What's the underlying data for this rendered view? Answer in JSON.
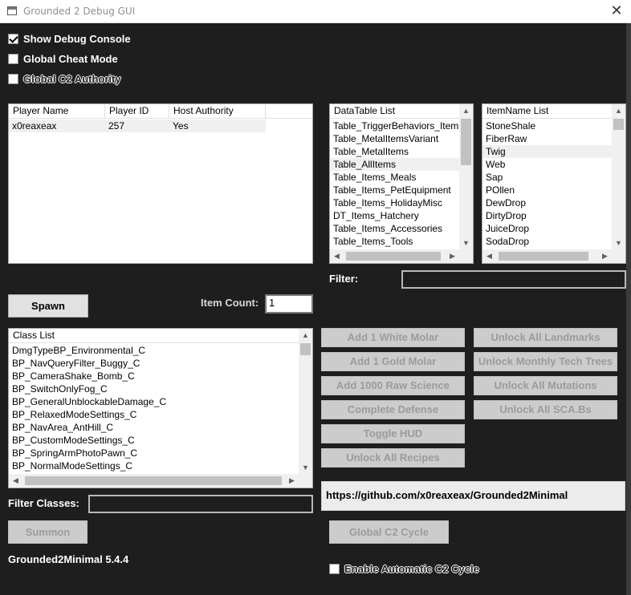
{
  "window": {
    "title": "Grounded 2 Debug GUI",
    "close_glyph": "✕"
  },
  "checkboxes": {
    "show_debug_console": {
      "label": "Show Debug Console",
      "checked": true
    },
    "global_cheat_mode": {
      "label": "Global Cheat Mode",
      "checked": false
    },
    "global_c2_authority": {
      "label": "Global C2 Authority",
      "checked": false
    },
    "enable_auto_c2": {
      "label": "Enable Automatic C2 Cycle",
      "checked": false
    }
  },
  "players": {
    "columns": [
      "Player Name",
      "Player ID",
      "Host Authority"
    ],
    "rows": [
      [
        "x0reaxeax",
        "257",
        "Yes"
      ]
    ]
  },
  "datatable_list": {
    "header": "DataTable List",
    "items": [
      "Table_TriggerBehaviors_Items",
      "Table_MetalItemsVariant",
      "Table_MetalItems",
      "Table_AllItems",
      "Table_Items_Meals",
      "Table_Items_PetEquipment",
      "Table_Items_HolidayMisc",
      "DT_Items_Hatchery",
      "Table_Items_Accessories",
      "Table_Items_Tools"
    ],
    "selected": 3
  },
  "itemname_list": {
    "header": "ItemName List",
    "items": [
      "StoneShale",
      "FiberRaw",
      "Twig",
      "Web",
      "Sap",
      "POllen",
      "DewDrop",
      "DirtyDrop",
      "JuiceDrop",
      "SodaDrop"
    ],
    "selected": 2
  },
  "filter": {
    "label": "Filter:",
    "value": ""
  },
  "spawn": {
    "button_label": "Spawn",
    "item_count_label": "Item Count:",
    "item_count_value": "1"
  },
  "class_list": {
    "header": "Class List",
    "items": [
      "DmgTypeBP_Environmental_C",
      "BP_NavQueryFilter_Buggy_C",
      "BP_CameraShake_Bomb_C",
      "BP_SwitchOnlyFog_C",
      "BP_GeneralUnblockableDamage_C",
      "BP_RelaxedModeSettings_C",
      "BP_NavArea_AntHill_C",
      "BP_CustomModeSettings_C",
      "BP_SpringArmPhotoPawn_C",
      "BP_NormalModeSettings_C"
    ]
  },
  "actions_left": [
    "Add 1 White Molar",
    "Add 1 Gold Molar",
    "Add 1000 Raw Science",
    "Complete Defense",
    "Toggle HUD",
    "Unlock All Recipes"
  ],
  "actions_right": [
    "Unlock All Landmarks",
    "Unlock Monthly Tech Trees",
    "Unlock All Mutations",
    "Unlock All SCA.Bs"
  ],
  "filter_classes": {
    "label": "Filter Classes:",
    "value": ""
  },
  "summon": {
    "label": "Summon"
  },
  "version": "Grounded2Minimal 5.4.4",
  "link": "https://github.com/x0reaxeax/Grounded2Minimal",
  "global_c2_cycle": {
    "label": "Global C2 Cycle"
  },
  "scroll_glyphs": {
    "up": "▲",
    "down": "▼",
    "left": "◀",
    "right": "▶"
  }
}
